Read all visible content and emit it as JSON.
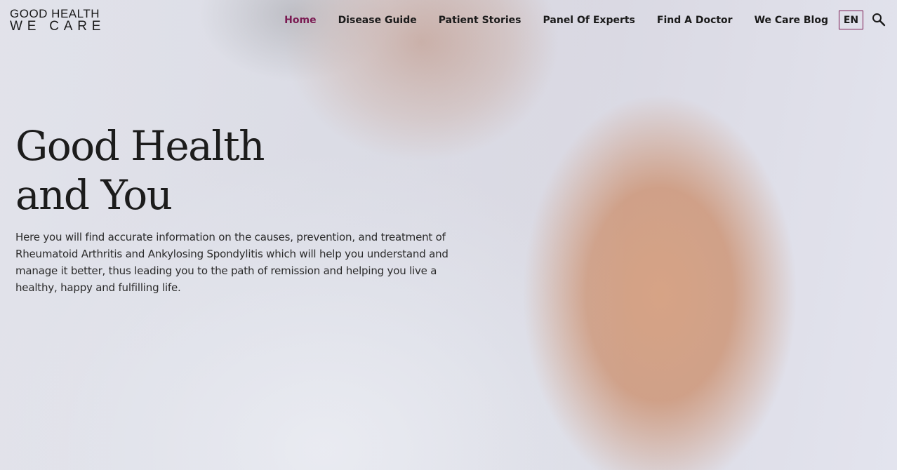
{
  "logo": {
    "line1": "GOOD HEALTH",
    "line2": "WE CARE"
  },
  "nav": {
    "items": [
      {
        "label": "Home",
        "active": true
      },
      {
        "label": "Disease Guide",
        "active": false
      },
      {
        "label": "Patient Stories",
        "active": false
      },
      {
        "label": "Panel Of Experts",
        "active": false
      },
      {
        "label": "Find A Doctor",
        "active": false
      },
      {
        "label": "We Care Blog",
        "active": false
      }
    ],
    "language": "EN",
    "search_icon": "search-icon"
  },
  "hero": {
    "title_line1": "Good Health",
    "title_line2": "and You",
    "description": "Here you will find accurate information on the causes, prevention, and treatment of Rheumatoid Arthritis and Ankylosing Spondylitis which will help you understand and manage it better, thus leading you to the path of remission and helping you live a healthy, happy and fulfilling life."
  },
  "colors": {
    "accent": "#7a1a52",
    "text": "#1a1a1a"
  }
}
